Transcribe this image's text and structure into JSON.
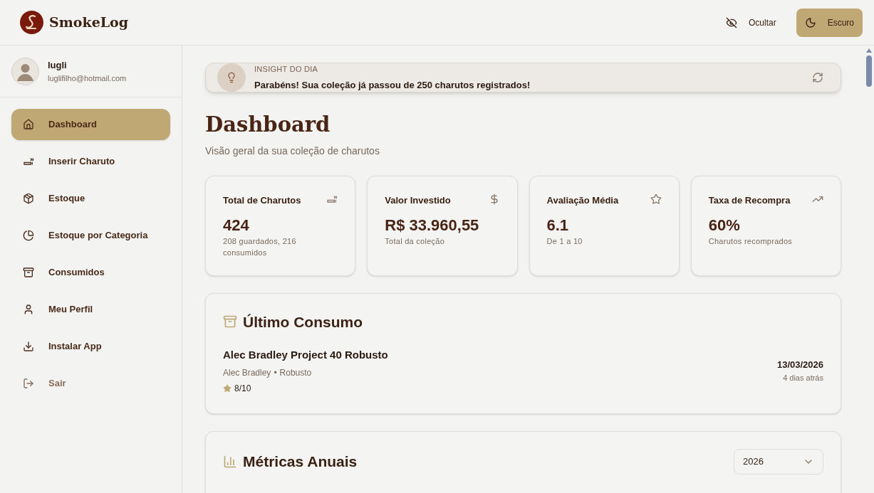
{
  "header": {
    "logo_text": "SmokeLog",
    "hide_button": "Ocultar",
    "theme_button": "Escuro"
  },
  "user": {
    "name": "lugli",
    "email": "luglifilho@hotmail.com"
  },
  "sidebar": {
    "items": [
      {
        "label": "Dashboard",
        "selected": true,
        "kind": "nav"
      },
      {
        "label": "Inserir Charuto",
        "selected": false,
        "kind": "nav"
      },
      {
        "label": "Estoque",
        "selected": false,
        "kind": "nav"
      },
      {
        "label": "Estoque por Categoria",
        "selected": false,
        "kind": "nav"
      },
      {
        "label": "Consumidos",
        "selected": false,
        "kind": "nav"
      },
      {
        "label": "Meu Perfil",
        "selected": false,
        "kind": "nav"
      },
      {
        "label": "Instalar App",
        "selected": false,
        "kind": "nav"
      },
      {
        "label": "Sair",
        "selected": false,
        "kind": "logout"
      }
    ]
  },
  "insight": {
    "label": "INSIGHT DO DIA",
    "text": "Parabéns! Sua coleção já passou de 250 charutos registrados!"
  },
  "page": {
    "title": "Dashboard",
    "subtitle": "Visão geral da sua coleção de charutos"
  },
  "stats": [
    {
      "title": "Total de Charutos",
      "value": "424",
      "note": "208 guardados, 216 consumidos"
    },
    {
      "title": "Valor Investido",
      "value": "R$ 33.960,55",
      "note": "Total da coleção"
    },
    {
      "title": "Avaliação Média",
      "value": "6.1",
      "note": "De 1 a 10"
    },
    {
      "title": "Taxa de Recompra",
      "value": "60%",
      "note": "Charutos recomprados"
    }
  ],
  "last_consumption": {
    "title": "Último Consumo",
    "cigar": "Alec Bradley Project 40 Robusto",
    "brand": "Alec Bradley",
    "separator": "•",
    "vitola": "Robusto",
    "rating": "8/10",
    "date": "13/03/2026",
    "ago": "4 dias atrás"
  },
  "annual_metrics": {
    "title": "Métricas Anuais",
    "year": "2026"
  }
}
